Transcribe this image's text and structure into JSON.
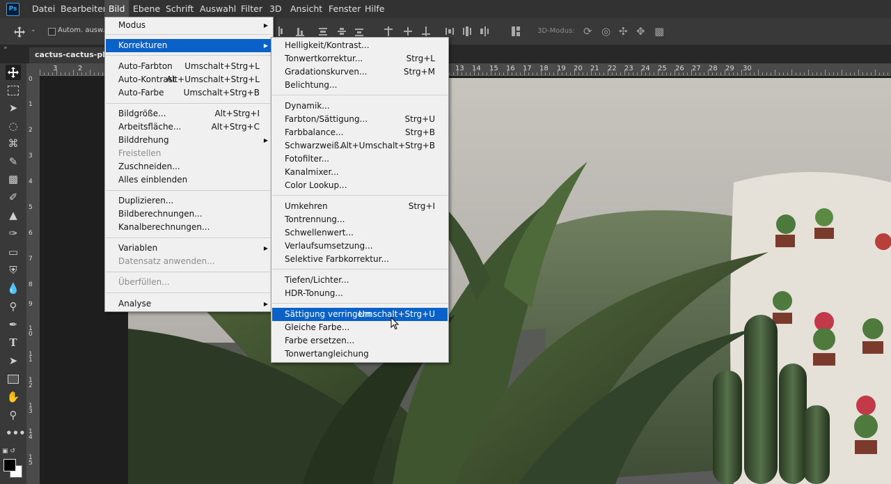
{
  "app": {
    "logo": "Ps"
  },
  "menubar": {
    "items": [
      "Datei",
      "Bearbeiten",
      "Bild",
      "Ebene",
      "Schrift",
      "Auswahl",
      "Filter",
      "3D",
      "Ansicht",
      "Fenster",
      "Hilfe"
    ],
    "active": "Bild"
  },
  "options": {
    "auto_select_label": "Autom. ausw.:",
    "mode3d_label": "3D-Modus:"
  },
  "document": {
    "tab_label": "cactus-cactus-plant"
  },
  "ruler_top": {
    "labels": [
      "3",
      "2",
      "13",
      "14",
      "15",
      "16",
      "17",
      "18",
      "19",
      "20",
      "21",
      "22",
      "23",
      "24",
      "25",
      "26",
      "27",
      "28",
      "29",
      "30"
    ]
  },
  "ruler_left": {
    "labels": [
      "0",
      "1",
      "2",
      "3",
      "4",
      "5",
      "6",
      "7",
      "8",
      "9",
      "1 0",
      "1 1",
      "1 2",
      "1 3",
      "1 4",
      "1 5"
    ]
  },
  "bild_menu": {
    "items": [
      {
        "label": "Modus",
        "submenu": true
      },
      {
        "label": "Korrekturen",
        "submenu": true,
        "highlighted": true
      },
      {
        "label": "Auto-Farbton",
        "shortcut": "Umschalt+Strg+L"
      },
      {
        "label": "Auto-Kontrast",
        "shortcut": "Alt+Umschalt+Strg+L"
      },
      {
        "label": "Auto-Farbe",
        "shortcut": "Umschalt+Strg+B"
      },
      {
        "label": "Bildgröße...",
        "shortcut": "Alt+Strg+I"
      },
      {
        "label": "Arbeitsfläche...",
        "shortcut": "Alt+Strg+C"
      },
      {
        "label": "Bilddrehung",
        "submenu": true
      },
      {
        "label": "Freistellen",
        "disabled": true
      },
      {
        "label": "Zuschneiden..."
      },
      {
        "label": "Alles einblenden"
      },
      {
        "label": "Duplizieren..."
      },
      {
        "label": "Bildberechnungen..."
      },
      {
        "label": "Kanalberechnungen..."
      },
      {
        "label": "Variablen",
        "submenu": true
      },
      {
        "label": "Datensatz anwenden...",
        "disabled": true
      },
      {
        "label": "Überfüllen...",
        "disabled": true
      },
      {
        "label": "Analyse",
        "submenu": true
      }
    ]
  },
  "korrekturen_menu": {
    "items": [
      {
        "label": "Helligkeit/Kontrast..."
      },
      {
        "label": "Tonwertkorrektur...",
        "shortcut": "Strg+L"
      },
      {
        "label": "Gradationskurven...",
        "shortcut": "Strg+M"
      },
      {
        "label": "Belichtung..."
      },
      {
        "label": "Dynamik..."
      },
      {
        "label": "Farbton/Sättigung...",
        "shortcut": "Strg+U"
      },
      {
        "label": "Farbbalance...",
        "shortcut": "Strg+B"
      },
      {
        "label": "Schwarzweiß...",
        "shortcut": "Alt+Umschalt+Strg+B"
      },
      {
        "label": "Fotofilter..."
      },
      {
        "label": "Kanalmixer..."
      },
      {
        "label": "Color Lookup..."
      },
      {
        "label": "Umkehren",
        "shortcut": "Strg+I"
      },
      {
        "label": "Tontrennung..."
      },
      {
        "label": "Schwellenwert..."
      },
      {
        "label": "Verlaufsumsetzung..."
      },
      {
        "label": "Selektive Farbkorrektur..."
      },
      {
        "label": "Tiefen/Lichter..."
      },
      {
        "label": "HDR-Tonung..."
      },
      {
        "label": "Sättigung verringern",
        "shortcut": "Umschalt+Strg+U",
        "highlighted": true
      },
      {
        "label": "Gleiche Farbe..."
      },
      {
        "label": "Farbe ersetzen..."
      },
      {
        "label": "Tonwertangleichung"
      }
    ]
  },
  "colors": {
    "highlight": "#0a62c9",
    "menu_bg": "#f0f0f0",
    "chrome": "#393939"
  }
}
